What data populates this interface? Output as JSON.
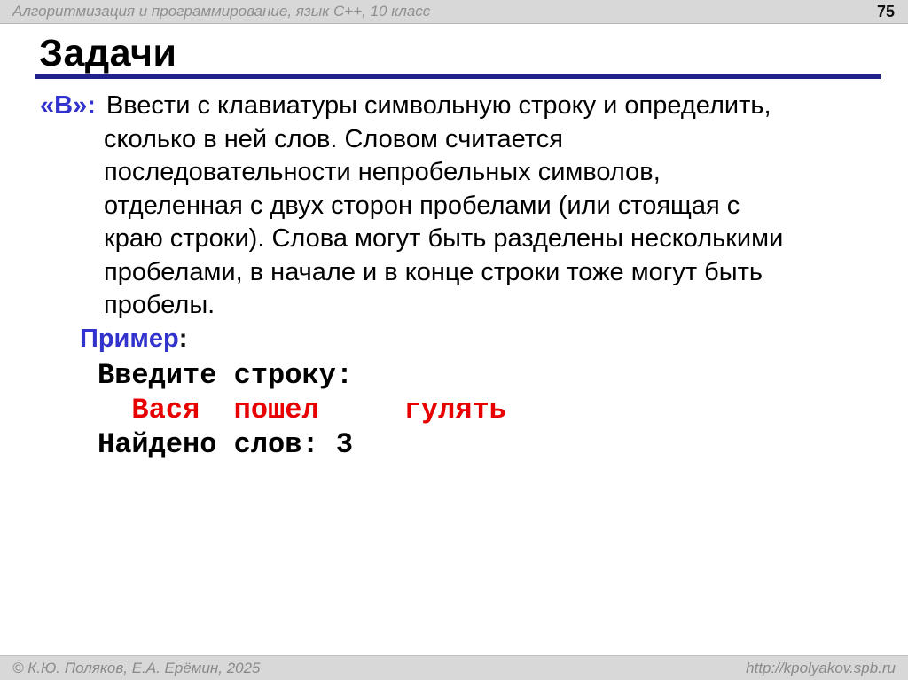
{
  "colors": {
    "accent_blue": "#3232cd",
    "underline_navy": "#21218c",
    "highlight_red": "#e80000",
    "bar_gray": "#d8d8d8",
    "bar_text_gray": "#8a8a8a"
  },
  "header": {
    "course_title": "Алгоритмизация и программирование, язык C++, 10 класс",
    "page_number": "75"
  },
  "title": {
    "text": "Задачи"
  },
  "task": {
    "level_prefix": "«B»:",
    "lines": [
      "Ввести с клавиатуры символьную строку и определить,",
      "сколько в ней слов. Словом считается",
      "последовательности непробельных символов,",
      "отделенная с двух сторон пробелами (или стоящая с",
      "краю строки). Слова могут быть разделены несколькими",
      "пробелами, в начале и в конце строки тоже могут быть",
      "пробелы."
    ],
    "example_label": "Пример",
    "example_colon": ":"
  },
  "example": {
    "prompt_line": "Введите строку:",
    "input_line": "  Вася  пошел     гулять",
    "result_line": "Найдено слов: 3"
  },
  "footer": {
    "copyright": "© К.Ю. Поляков, Е.А. Ерёмин, 2025",
    "url": "http://kpolyakov.spb.ru"
  }
}
